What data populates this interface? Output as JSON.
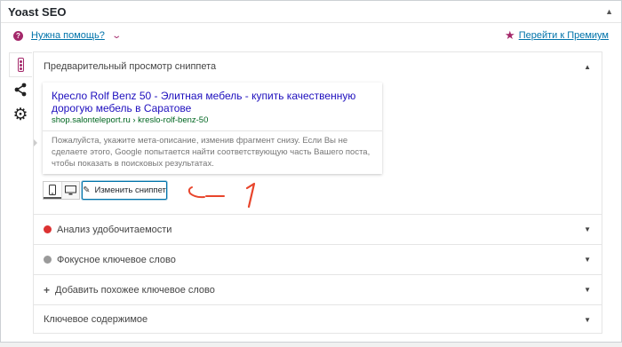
{
  "metabox": {
    "title": "Yoast SEO",
    "toggle_icon": "triangle-up"
  },
  "help": {
    "link_label": "Нужна помощь?",
    "premium_label": "Перейти к Премиум"
  },
  "tabs": [
    {
      "name": "readability-traffic-light-icon"
    },
    {
      "name": "share-icon"
    },
    {
      "name": "gear-icon"
    }
  ],
  "snippet_section": {
    "heading": "Предварительный просмотр сниппета",
    "title": "Кресло Rolf Benz 50 - Элитная мебель - купить качественную дорогую мебель в Саратове",
    "url": "shop.salonteleport.ru › kreslo-rolf-benz-50",
    "description": "Пожалуйста, укажите мета-описание, изменив фрагмент снизу. Если Вы не сделаете этого, Google попытается найти соответствующую часть Вашего поста, чтобы показать в поисковых результатах.",
    "edit_label": "Изменить сниппет",
    "annotation": "1"
  },
  "accordions": [
    {
      "label": "Анализ удобочитаемости",
      "icon": "sad-face-icon"
    },
    {
      "label": "Фокусное ключевое слово",
      "icon": "grey-dot-icon"
    },
    {
      "label": "Добавить похожее ключевое слово",
      "icon": "plus-icon"
    },
    {
      "label": "Ключевое содержимое",
      "icon": ""
    }
  ],
  "colors": {
    "brand": "#a4286a",
    "link": "#0073aa",
    "serp_title": "#1e0fbe",
    "serp_url": "#006621",
    "error": "#dc3232",
    "annotation": "#e8452c"
  }
}
